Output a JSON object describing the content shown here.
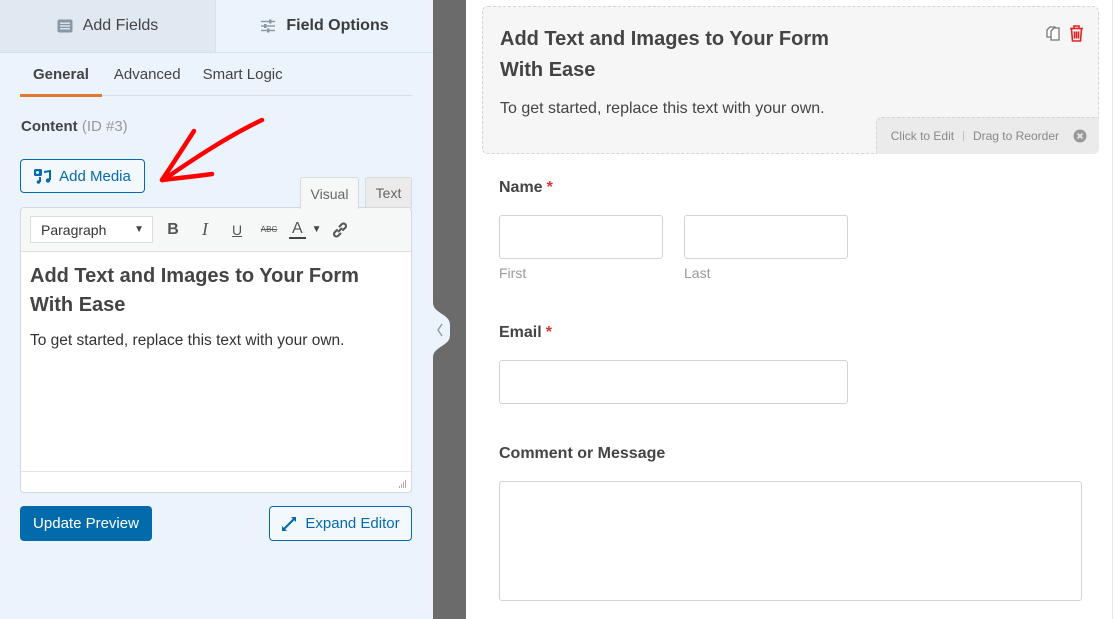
{
  "left_panel": {
    "top_tabs": [
      {
        "label": "Add Fields",
        "icon": "list-icon",
        "active": false
      },
      {
        "label": "Field Options",
        "icon": "sliders-icon",
        "active": true
      }
    ],
    "sub_tabs": [
      {
        "label": "General",
        "active": true
      },
      {
        "label": "Advanced",
        "active": false
      },
      {
        "label": "Smart Logic",
        "active": false
      }
    ],
    "content_label": "Content",
    "content_id": "(ID #3)",
    "add_media_label": "Add Media",
    "editor_tabs": {
      "visual": "Visual",
      "text": "Text",
      "active": "Visual"
    },
    "toolbar": {
      "format_select": "Paragraph",
      "bold": "B",
      "italic": "I",
      "underline": "U",
      "strikethrough": "ABC",
      "text_color": "A"
    },
    "editor_content": {
      "heading": "Add Text and Images to Your Form With Ease",
      "paragraph": "To get started, replace this text with your own."
    },
    "update_preview_label": "Update Preview",
    "expand_editor_label": "Expand Editor"
  },
  "right_panel": {
    "content_block": {
      "title": "Add Text and Images to Your Form With Ease",
      "text": "To get started, replace this text with your own.",
      "hint_edit": "Click to Edit",
      "hint_separator": "|",
      "hint_reorder": "Drag to Reorder"
    },
    "fields": {
      "name": {
        "label": "Name",
        "required": "*",
        "sub_first": "First",
        "sub_last": "Last",
        "first_value": "",
        "last_value": ""
      },
      "email": {
        "label": "Email",
        "required": "*",
        "value": ""
      },
      "comment": {
        "label": "Comment or Message",
        "value": ""
      }
    }
  },
  "colors": {
    "accent_blue": "#036aab",
    "active_tab_underline": "#e27730",
    "required_red": "#d63638",
    "delete_red": "#e02424",
    "annotation_red": "#ff0000"
  }
}
